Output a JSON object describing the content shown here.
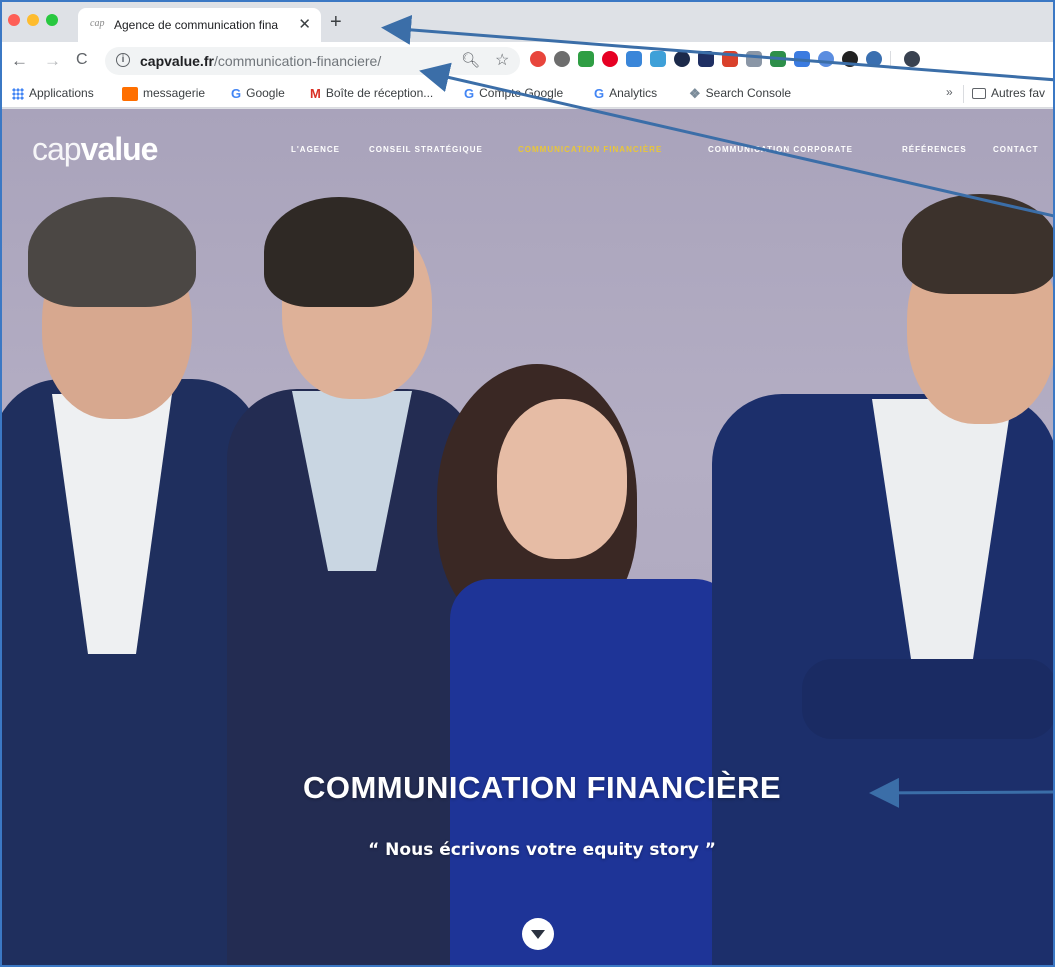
{
  "browser": {
    "tab": {
      "favicon_text": "cap",
      "title": "Agence de communication fina",
      "close": "✕"
    },
    "new_tab": "+",
    "nav": {
      "back": "←",
      "forward": "→",
      "reload": "C"
    },
    "address": {
      "host": "capvalue.fr",
      "path": "/communication-financiere/"
    },
    "bookmarks": [
      {
        "label": "Applications"
      },
      {
        "label": "messagerie"
      },
      {
        "label": "Google",
        "icon": "G"
      },
      {
        "label": "Boîte de réception...",
        "icon": "M"
      },
      {
        "label": "Compte Google",
        "icon": "G"
      },
      {
        "label": "Analytics",
        "icon": "G"
      },
      {
        "label": "Search Console",
        "icon": "❖"
      }
    ],
    "bookmarks_more": "»",
    "other_bookmarks": "Autres fav"
  },
  "site": {
    "logo": {
      "light": "cap",
      "bold": "value"
    },
    "nav": [
      {
        "label": "L'AGENCE",
        "active": false
      },
      {
        "label": "CONSEIL STRATÉGIQUE",
        "active": false
      },
      {
        "label": "COMMUNICATION FINANCIÈRE",
        "active": true
      },
      {
        "label": "COMMUNICATION CORPORATE",
        "active": false
      },
      {
        "label": "RÉFÉRENCES",
        "active": false
      },
      {
        "label": "CONTACT",
        "active": false
      }
    ],
    "hero": {
      "title": "COMMUNICATION FINANCIÈRE",
      "quote": "“ Nous écrivons votre equity story ”"
    }
  },
  "colors": {
    "annotation_arrow": "#3b6ea8",
    "active_nav": "#e8c63a",
    "suit_navy": "#1f2f63"
  }
}
